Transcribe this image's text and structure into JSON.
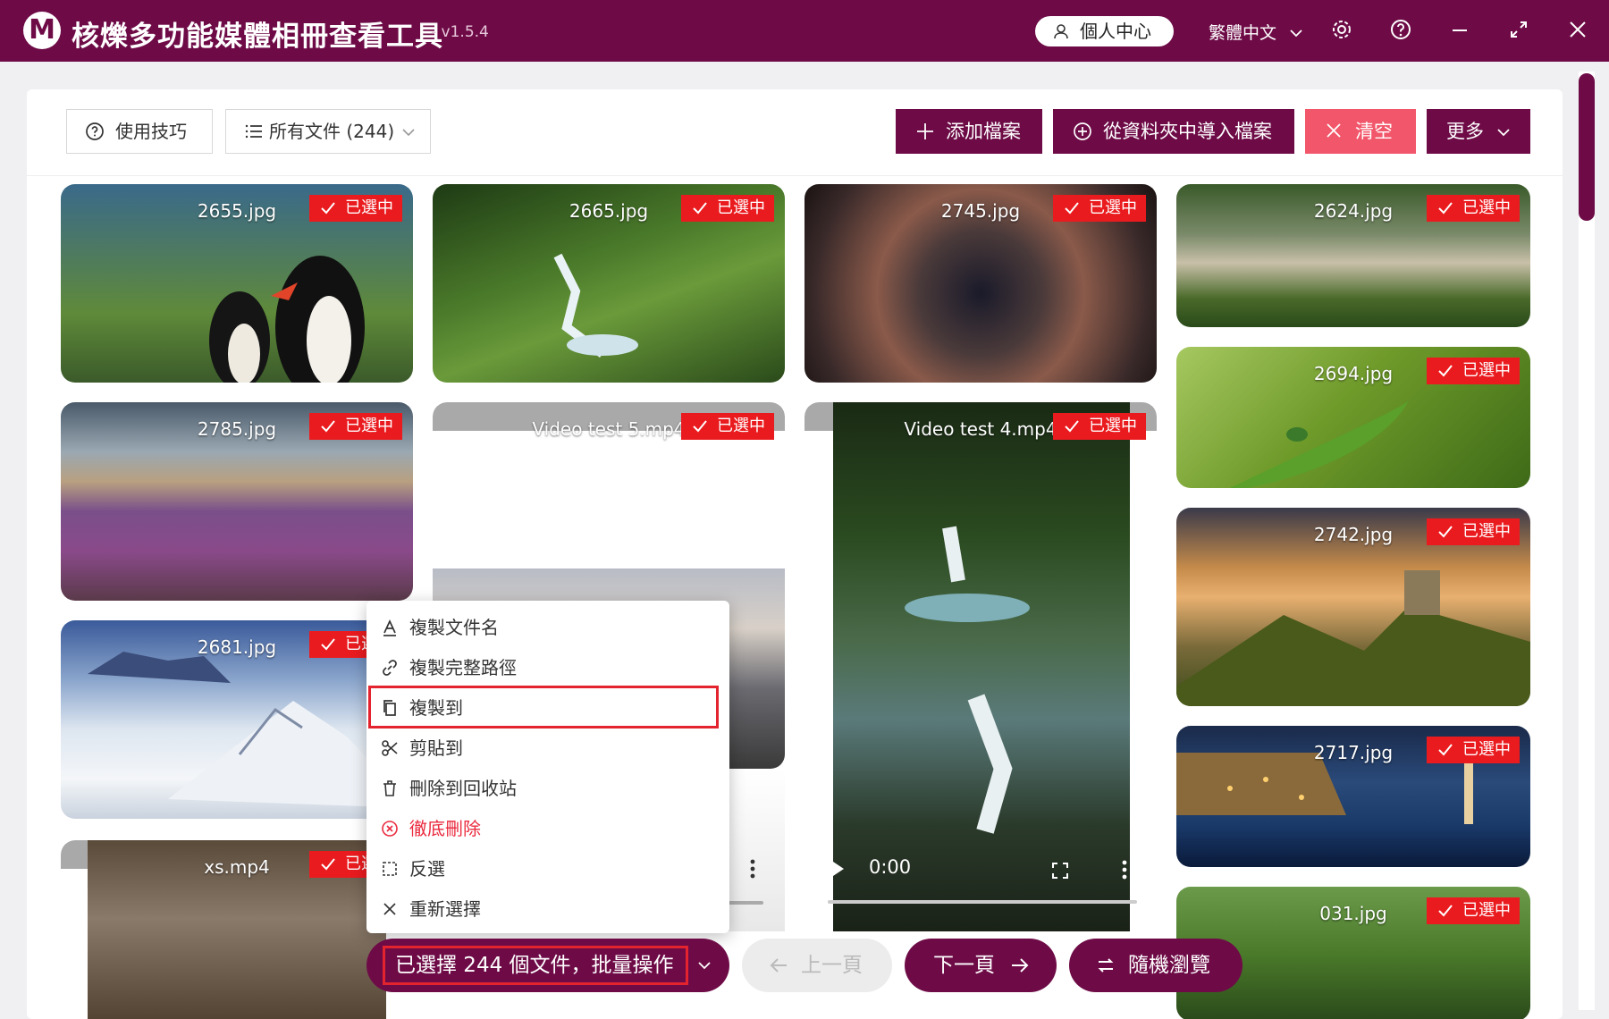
{
  "app": {
    "title": "核爍多功能媒體相冊查看工具",
    "version": "- v1.5.4",
    "profile": "個人中心",
    "language": "繁體中文"
  },
  "toolbar": {
    "tips": "使用技巧",
    "filter": "所有文件 (244)",
    "add": "添加檔案",
    "import": "從資料夾中導入檔案",
    "clear": "清空",
    "more": "更多"
  },
  "badge_label": "已選中",
  "cards": [
    {
      "name": "2655.jpg"
    },
    {
      "name": "2665.jpg"
    },
    {
      "name": "2745.jpg"
    },
    {
      "name": "2624.jpg"
    },
    {
      "name": "2694.jpg"
    },
    {
      "name": "2785.jpg"
    },
    {
      "name": "Video test 5.mp4"
    },
    {
      "name": "Video test 4.mp4",
      "time": "0:00"
    },
    {
      "name": "2742.jpg"
    },
    {
      "name": "2681.jpg"
    },
    {
      "name": "2717.jpg"
    },
    {
      "name": "xs.mp4"
    },
    {
      "name": "031.jpg"
    }
  ],
  "context_menu": {
    "items": [
      {
        "label": "複製文件名",
        "icon": "text-a-icon"
      },
      {
        "label": "複製完整路徑",
        "icon": "link-icon"
      },
      {
        "label": "複製到",
        "icon": "copy-icon"
      },
      {
        "label": "剪貼到",
        "icon": "scissors-icon"
      },
      {
        "label": "刪除到回收站",
        "icon": "trash-icon"
      },
      {
        "label": "徹底刪除",
        "icon": "close-circle-icon"
      },
      {
        "label": "反選",
        "icon": "invert-select-icon"
      },
      {
        "label": "重新選擇",
        "icon": "close-icon"
      }
    ]
  },
  "bottom": {
    "batch": "已選擇 244 個文件，批量操作",
    "prev": "上一頁",
    "next": "下一頁",
    "random": "隨機瀏覽"
  },
  "colors": {
    "brand": "#6e0b47",
    "badge": "#ea1b1f",
    "clear": "#f2566a",
    "highlight": "#e3232d"
  }
}
